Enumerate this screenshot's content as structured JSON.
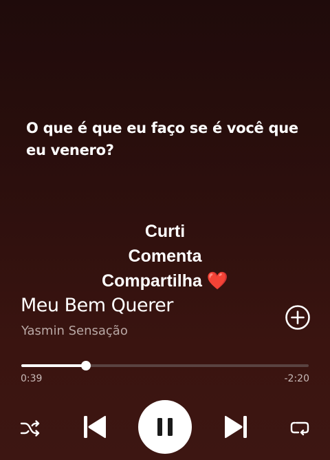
{
  "lyrics": {
    "current_line": "O que é que eu faço se é você que eu venero?"
  },
  "overlay": {
    "line1": "Curti",
    "line2": "Comenta",
    "line3": "Compartilha",
    "heart": "❤️"
  },
  "track": {
    "title": "Meu Bem Querer",
    "artist": "Yasmin Sensação"
  },
  "progress": {
    "elapsed": "0:39",
    "remaining": "-2:20",
    "fraction": 0.225
  },
  "controls": {
    "shuffle": "shuffle-icon",
    "previous": "skip-back-icon",
    "play_pause": "pause-icon",
    "next": "skip-forward-icon",
    "repeat": "repeat-icon",
    "add": "add-circle-icon"
  },
  "colors": {
    "background": "#2c0f0d",
    "text": "#ffffff",
    "artist_text": "#b9a8a5",
    "heart": "#e0202a"
  }
}
